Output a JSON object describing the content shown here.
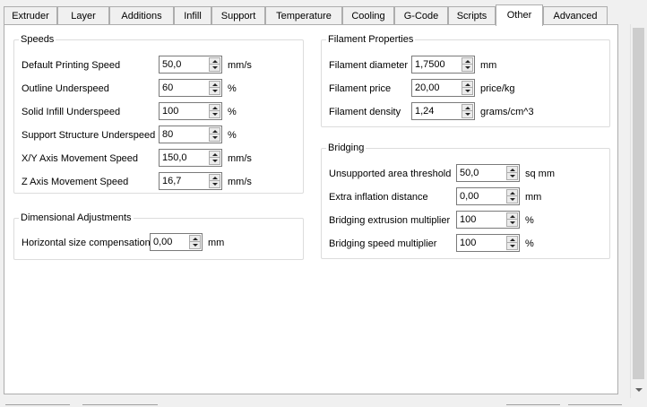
{
  "tabs": [
    {
      "label": "Extruder"
    },
    {
      "label": "Layer"
    },
    {
      "label": "Additions"
    },
    {
      "label": "Infill"
    },
    {
      "label": "Support"
    },
    {
      "label": "Temperature"
    },
    {
      "label": "Cooling"
    },
    {
      "label": "G-Code"
    },
    {
      "label": "Scripts"
    },
    {
      "label": "Other",
      "active": true
    },
    {
      "label": "Advanced"
    }
  ],
  "speeds": {
    "title": "Speeds",
    "rows": [
      {
        "label": "Default Printing Speed",
        "value": "50,0",
        "unit": "mm/s"
      },
      {
        "label": "Outline Underspeed",
        "value": "60",
        "unit": "%"
      },
      {
        "label": "Solid Infill Underspeed",
        "value": "100",
        "unit": "%"
      },
      {
        "label": "Support Structure Underspeed",
        "value": "80",
        "unit": "%"
      },
      {
        "label": "X/Y Axis Movement Speed",
        "value": "150,0",
        "unit": "mm/s"
      },
      {
        "label": "Z Axis Movement Speed",
        "value": "16,7",
        "unit": "mm/s"
      }
    ]
  },
  "dimensional": {
    "title": "Dimensional Adjustments",
    "rows": [
      {
        "label": "Horizontal size compensation",
        "value": "0,00",
        "unit": "mm"
      }
    ]
  },
  "filament": {
    "title": "Filament Properties",
    "rows": [
      {
        "label": "Filament diameter",
        "value": "1,7500",
        "unit": "mm"
      },
      {
        "label": "Filament price",
        "value": "20,00",
        "unit": "price/kg"
      },
      {
        "label": "Filament density",
        "value": "1,24",
        "unit": "grams/cm^3"
      }
    ]
  },
  "bridging": {
    "title": "Bridging",
    "rows": [
      {
        "label": "Unsupported area threshold",
        "value": "50,0",
        "unit": "sq mm"
      },
      {
        "label": "Extra inflation distance",
        "value": "0,00",
        "unit": "mm"
      },
      {
        "label": "Bridging extrusion multiplier",
        "value": "100",
        "unit": "%"
      },
      {
        "label": "Bridging speed multiplier",
        "value": "100",
        "unit": "%"
      }
    ]
  }
}
